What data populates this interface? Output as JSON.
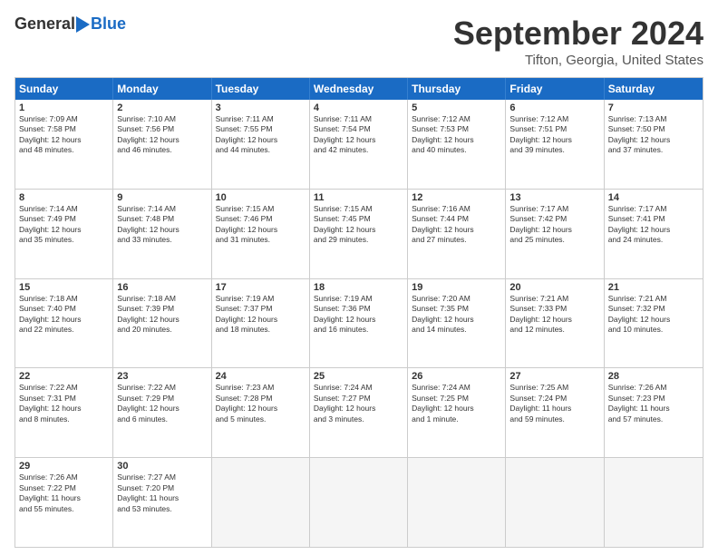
{
  "header": {
    "logo_general": "General",
    "logo_blue": "Blue",
    "month": "September 2024",
    "location": "Tifton, Georgia, United States"
  },
  "days": [
    "Sunday",
    "Monday",
    "Tuesday",
    "Wednesday",
    "Thursday",
    "Friday",
    "Saturday"
  ],
  "rows": [
    [
      {
        "day": "1",
        "lines": [
          "Sunrise: 7:09 AM",
          "Sunset: 7:58 PM",
          "Daylight: 12 hours",
          "and 48 minutes."
        ]
      },
      {
        "day": "2",
        "lines": [
          "Sunrise: 7:10 AM",
          "Sunset: 7:56 PM",
          "Daylight: 12 hours",
          "and 46 minutes."
        ]
      },
      {
        "day": "3",
        "lines": [
          "Sunrise: 7:11 AM",
          "Sunset: 7:55 PM",
          "Daylight: 12 hours",
          "and 44 minutes."
        ]
      },
      {
        "day": "4",
        "lines": [
          "Sunrise: 7:11 AM",
          "Sunset: 7:54 PM",
          "Daylight: 12 hours",
          "and 42 minutes."
        ]
      },
      {
        "day": "5",
        "lines": [
          "Sunrise: 7:12 AM",
          "Sunset: 7:53 PM",
          "Daylight: 12 hours",
          "and 40 minutes."
        ]
      },
      {
        "day": "6",
        "lines": [
          "Sunrise: 7:12 AM",
          "Sunset: 7:51 PM",
          "Daylight: 12 hours",
          "and 39 minutes."
        ]
      },
      {
        "day": "7",
        "lines": [
          "Sunrise: 7:13 AM",
          "Sunset: 7:50 PM",
          "Daylight: 12 hours",
          "and 37 minutes."
        ]
      }
    ],
    [
      {
        "day": "8",
        "lines": [
          "Sunrise: 7:14 AM",
          "Sunset: 7:49 PM",
          "Daylight: 12 hours",
          "and 35 minutes."
        ]
      },
      {
        "day": "9",
        "lines": [
          "Sunrise: 7:14 AM",
          "Sunset: 7:48 PM",
          "Daylight: 12 hours",
          "and 33 minutes."
        ]
      },
      {
        "day": "10",
        "lines": [
          "Sunrise: 7:15 AM",
          "Sunset: 7:46 PM",
          "Daylight: 12 hours",
          "and 31 minutes."
        ]
      },
      {
        "day": "11",
        "lines": [
          "Sunrise: 7:15 AM",
          "Sunset: 7:45 PM",
          "Daylight: 12 hours",
          "and 29 minutes."
        ]
      },
      {
        "day": "12",
        "lines": [
          "Sunrise: 7:16 AM",
          "Sunset: 7:44 PM",
          "Daylight: 12 hours",
          "and 27 minutes."
        ]
      },
      {
        "day": "13",
        "lines": [
          "Sunrise: 7:17 AM",
          "Sunset: 7:42 PM",
          "Daylight: 12 hours",
          "and 25 minutes."
        ]
      },
      {
        "day": "14",
        "lines": [
          "Sunrise: 7:17 AM",
          "Sunset: 7:41 PM",
          "Daylight: 12 hours",
          "and 24 minutes."
        ]
      }
    ],
    [
      {
        "day": "15",
        "lines": [
          "Sunrise: 7:18 AM",
          "Sunset: 7:40 PM",
          "Daylight: 12 hours",
          "and 22 minutes."
        ]
      },
      {
        "day": "16",
        "lines": [
          "Sunrise: 7:18 AM",
          "Sunset: 7:39 PM",
          "Daylight: 12 hours",
          "and 20 minutes."
        ]
      },
      {
        "day": "17",
        "lines": [
          "Sunrise: 7:19 AM",
          "Sunset: 7:37 PM",
          "Daylight: 12 hours",
          "and 18 minutes."
        ]
      },
      {
        "day": "18",
        "lines": [
          "Sunrise: 7:19 AM",
          "Sunset: 7:36 PM",
          "Daylight: 12 hours",
          "and 16 minutes."
        ]
      },
      {
        "day": "19",
        "lines": [
          "Sunrise: 7:20 AM",
          "Sunset: 7:35 PM",
          "Daylight: 12 hours",
          "and 14 minutes."
        ]
      },
      {
        "day": "20",
        "lines": [
          "Sunrise: 7:21 AM",
          "Sunset: 7:33 PM",
          "Daylight: 12 hours",
          "and 12 minutes."
        ]
      },
      {
        "day": "21",
        "lines": [
          "Sunrise: 7:21 AM",
          "Sunset: 7:32 PM",
          "Daylight: 12 hours",
          "and 10 minutes."
        ]
      }
    ],
    [
      {
        "day": "22",
        "lines": [
          "Sunrise: 7:22 AM",
          "Sunset: 7:31 PM",
          "Daylight: 12 hours",
          "and 8 minutes."
        ]
      },
      {
        "day": "23",
        "lines": [
          "Sunrise: 7:22 AM",
          "Sunset: 7:29 PM",
          "Daylight: 12 hours",
          "and 6 minutes."
        ]
      },
      {
        "day": "24",
        "lines": [
          "Sunrise: 7:23 AM",
          "Sunset: 7:28 PM",
          "Daylight: 12 hours",
          "and 5 minutes."
        ]
      },
      {
        "day": "25",
        "lines": [
          "Sunrise: 7:24 AM",
          "Sunset: 7:27 PM",
          "Daylight: 12 hours",
          "and 3 minutes."
        ]
      },
      {
        "day": "26",
        "lines": [
          "Sunrise: 7:24 AM",
          "Sunset: 7:25 PM",
          "Daylight: 12 hours",
          "and 1 minute."
        ]
      },
      {
        "day": "27",
        "lines": [
          "Sunrise: 7:25 AM",
          "Sunset: 7:24 PM",
          "Daylight: 11 hours",
          "and 59 minutes."
        ]
      },
      {
        "day": "28",
        "lines": [
          "Sunrise: 7:26 AM",
          "Sunset: 7:23 PM",
          "Daylight: 11 hours",
          "and 57 minutes."
        ]
      }
    ],
    [
      {
        "day": "29",
        "lines": [
          "Sunrise: 7:26 AM",
          "Sunset: 7:22 PM",
          "Daylight: 11 hours",
          "and 55 minutes."
        ]
      },
      {
        "day": "30",
        "lines": [
          "Sunrise: 7:27 AM",
          "Sunset: 7:20 PM",
          "Daylight: 11 hours",
          "and 53 minutes."
        ]
      },
      {
        "day": "",
        "lines": [],
        "empty": true
      },
      {
        "day": "",
        "lines": [],
        "empty": true
      },
      {
        "day": "",
        "lines": [],
        "empty": true
      },
      {
        "day": "",
        "lines": [],
        "empty": true
      },
      {
        "day": "",
        "lines": [],
        "empty": true
      }
    ]
  ]
}
